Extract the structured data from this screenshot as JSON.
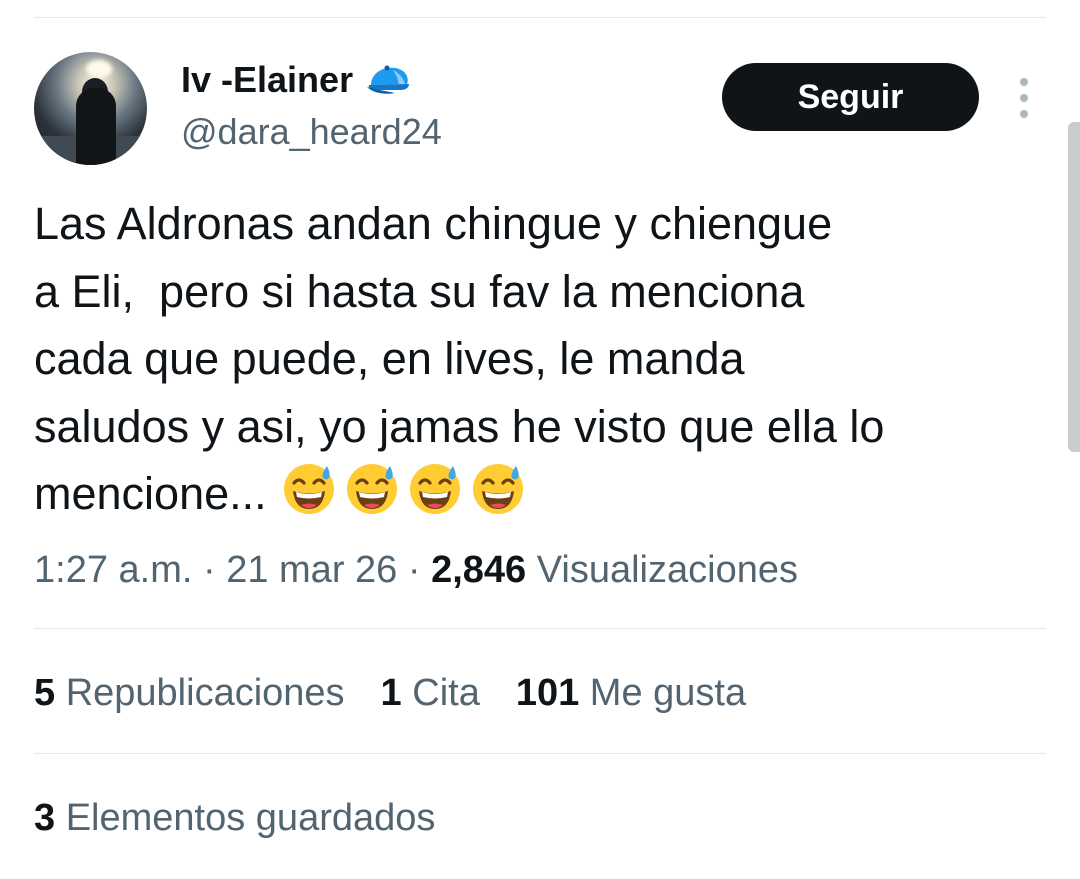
{
  "author": {
    "display_name": "Iv -Elainer",
    "handle": "@dara_heard24",
    "badge_icon": "blue-cap-icon"
  },
  "follow_button": {
    "label": "Seguir"
  },
  "more_menu": {
    "icon": "vertical-ellipsis-icon"
  },
  "tweet": {
    "text": "Las Aldronas andan chingue y chiengue\na Eli,  pero si hasta su fav la menciona\ncada que puede, en lives, le manda\nsaludos y asi, yo jamas he visto que ella lo\nmencione...",
    "emojis": [
      "😅",
      "😅",
      "😅",
      "😅"
    ]
  },
  "meta": {
    "time": "1:27 a.m.",
    "separator": "·",
    "date": "21 mar 26",
    "views_count": "2,846",
    "views_label": "Visualizaciones"
  },
  "stats": {
    "reposts_count": "5",
    "reposts_label": "Republicaciones",
    "quotes_count": "1",
    "quotes_label": "Cita",
    "likes_count": "101",
    "likes_label": "Me gusta"
  },
  "bookmarks": {
    "count": "3",
    "label": "Elementos guardados"
  },
  "colors": {
    "text_primary": "#0f1419",
    "text_secondary": "#536471",
    "divider": "#e7e9ea",
    "button_bg": "#0f1419",
    "button_text": "#ffffff",
    "badge_blue": "#1d9bf0"
  }
}
